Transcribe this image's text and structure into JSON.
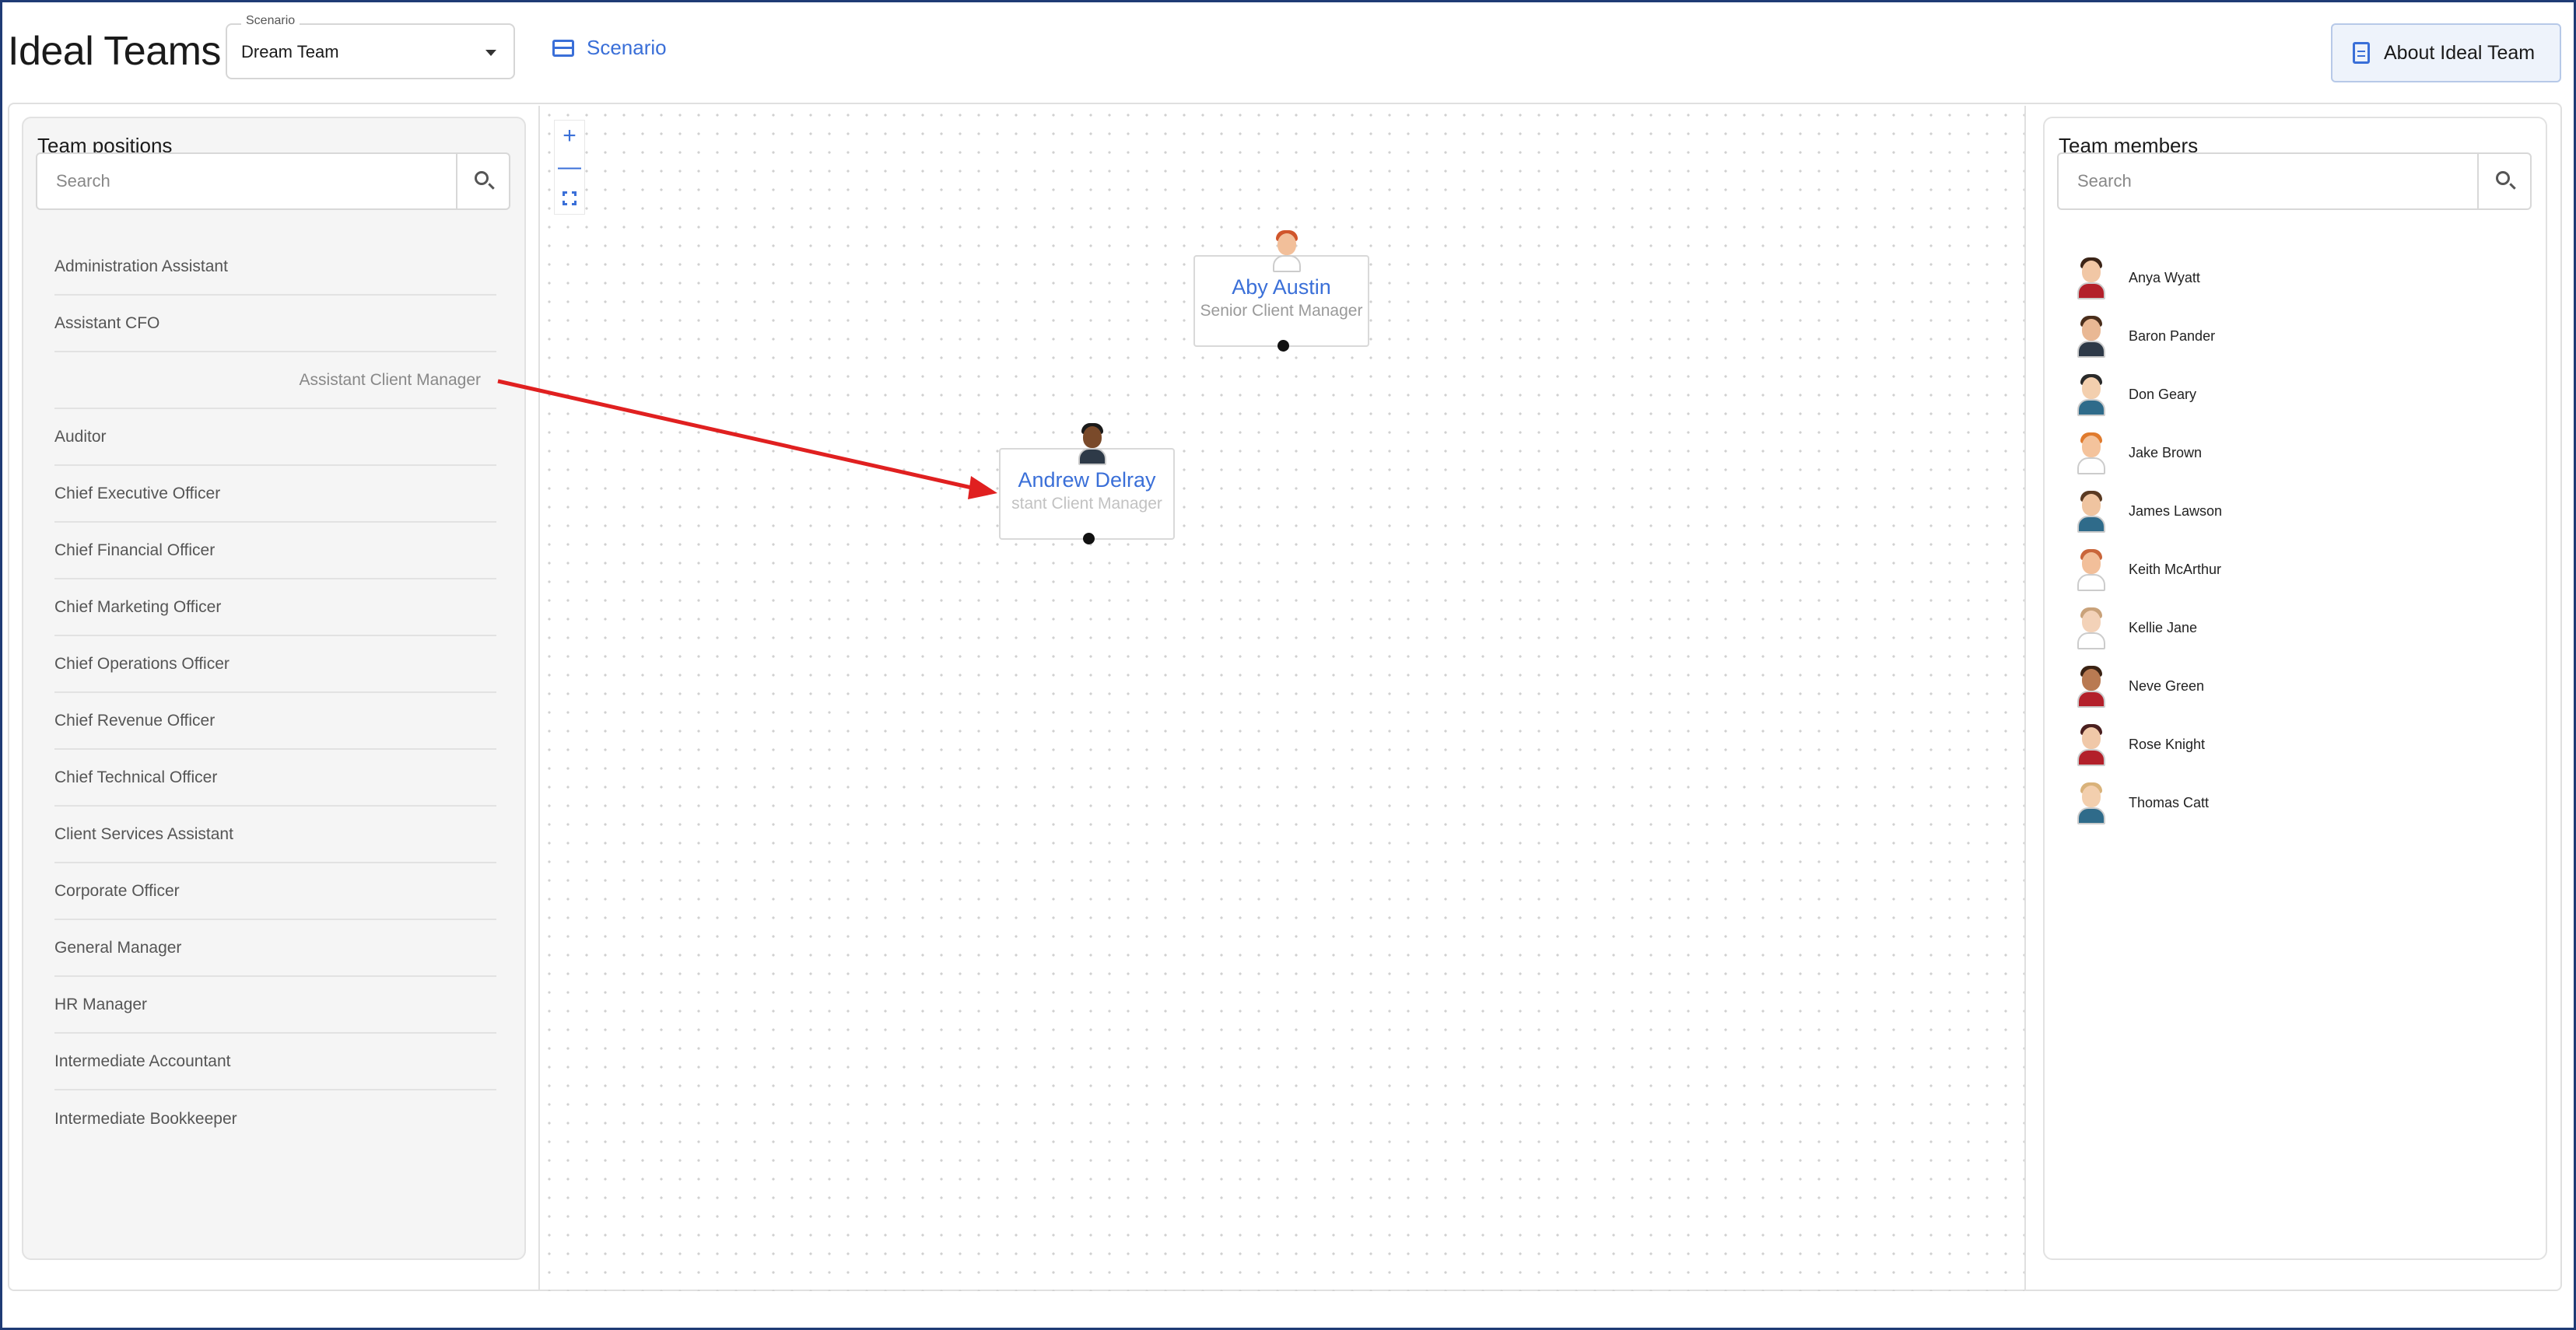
{
  "header": {
    "app_title": "Ideal Teams",
    "scenario_select": {
      "legend": "Scenario",
      "value": "Dream Team"
    },
    "scenario_link": "Scenario",
    "about_button": "About Ideal Team"
  },
  "left_panel": {
    "title": "Team positions",
    "search_placeholder": "Search",
    "positions": [
      "Administration Assistant",
      "Assistant CFO",
      "Assistant Client Manager",
      "Auditor",
      "Chief Executive Officer",
      "Chief Financial Officer",
      "Chief Marketing Officer",
      "Chief Operations Officer",
      "Chief Revenue Officer",
      "Chief Technical Officer",
      "Client Services Assistant",
      "Corporate Officer",
      "General Manager",
      "HR Manager",
      "Intermediate Accountant",
      "Intermediate Bookkeeper"
    ]
  },
  "right_panel": {
    "title": "Team members",
    "search_placeholder": "Search",
    "members": [
      {
        "name": "Anya Wyatt",
        "hair": "#3b2417",
        "skin": "#f1c7a5",
        "shirt": "#b3202a"
      },
      {
        "name": "Baron Pander",
        "hair": "#4a2e1c",
        "skin": "#e9b894",
        "shirt": "#2e3a48"
      },
      {
        "name": "Don Geary",
        "hair": "#2a2a2a",
        "skin": "#f3cfae",
        "shirt": "#2f6b8a"
      },
      {
        "name": "Jake Brown",
        "hair": "#e07b2e",
        "skin": "#f4c39c",
        "shirt": "#ffffff"
      },
      {
        "name": "James Lawson",
        "hair": "#5a3a22",
        "skin": "#efc4a0",
        "shirt": "#2f6b8a"
      },
      {
        "name": "Keith McArthur",
        "hair": "#c9653a",
        "skin": "#f2bf9a",
        "shirt": "#ffffff"
      },
      {
        "name": "Kellie Jane",
        "hair": "#c9a27a",
        "skin": "#f3d2b8",
        "shirt": "#ffffff"
      },
      {
        "name": "Neve Green",
        "hair": "#3a2214",
        "skin": "#b97a52",
        "shirt": "#b3202a"
      },
      {
        "name": "Rose Knight",
        "hair": "#4a1f1f",
        "skin": "#f0c8a8",
        "shirt": "#b3202a"
      },
      {
        "name": "Thomas Catt",
        "hair": "#d9b27a",
        "skin": "#f3cfae",
        "shirt": "#2f6b8a"
      }
    ]
  },
  "canvas": {
    "zoom_in": "+",
    "zoom_out": "—",
    "nodes": [
      {
        "name": "Aby Austin",
        "role": "Senior Client Manager",
        "hair": "#d0552b",
        "skin": "#f2bf9a",
        "shirt": "#ffffff"
      },
      {
        "name": "Andrew Delray",
        "role": "stant Client Manager",
        "hair": "#1a1a1a",
        "skin": "#7a4a2a",
        "shirt": "#2e3a48"
      }
    ],
    "annotation_color": "#e02020"
  }
}
